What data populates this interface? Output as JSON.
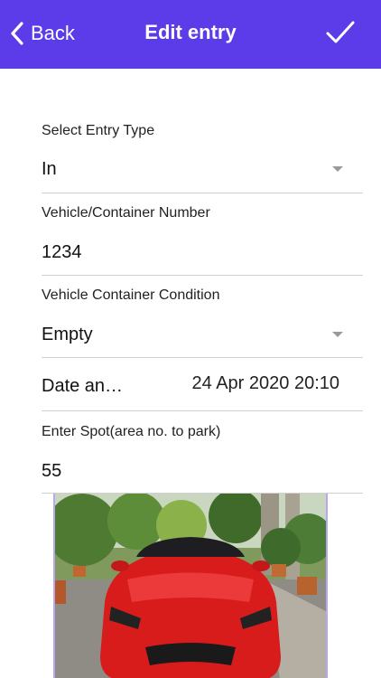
{
  "header": {
    "back_label": "Back",
    "title": "Edit entry"
  },
  "form": {
    "entry_type": {
      "label": "Select Entry Type",
      "value": "In"
    },
    "vehicle_number": {
      "label": "Vehicle/Container Number",
      "value": "1234"
    },
    "condition": {
      "label": "Vehicle Container Condition",
      "value": "Empty"
    },
    "date": {
      "label": "Date an…",
      "value": "24 Apr 2020 20:10"
    },
    "spot": {
      "label": "Enter Spot(area no. to park)",
      "value": "55"
    }
  },
  "colors": {
    "header_bg": "#5b3ce8",
    "header_text": "#ffffff",
    "divider": "#d0d0d0"
  },
  "icons": {
    "back": "chevron-left-icon",
    "save": "checkmark-icon",
    "dropdown": "caret-down-icon"
  }
}
